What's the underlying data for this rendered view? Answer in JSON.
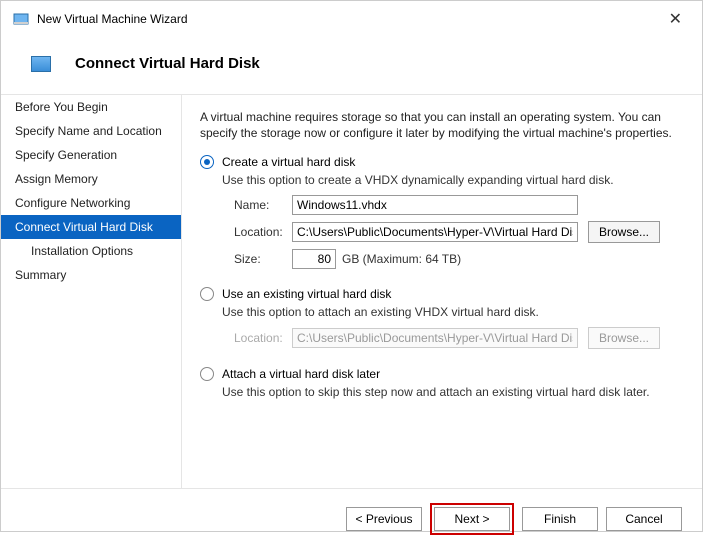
{
  "window": {
    "title": "New Virtual Machine Wizard"
  },
  "header": {
    "title": "Connect Virtual Hard Disk"
  },
  "sidebar": {
    "items": [
      {
        "label": "Before You Begin"
      },
      {
        "label": "Specify Name and Location"
      },
      {
        "label": "Specify Generation"
      },
      {
        "label": "Assign Memory"
      },
      {
        "label": "Configure Networking"
      },
      {
        "label": "Connect Virtual Hard Disk"
      },
      {
        "label": "Installation Options"
      },
      {
        "label": "Summary"
      }
    ]
  },
  "main": {
    "intro": "A virtual machine requires storage so that you can install an operating system. You can specify the storage now or configure it later by modifying the virtual machine's properties.",
    "opt_create": {
      "label": "Create a virtual hard disk",
      "desc": "Use this option to create a VHDX dynamically expanding virtual hard disk.",
      "name_label": "Name:",
      "name_value": "Windows11.vhdx",
      "loc_label": "Location:",
      "loc_value": "C:\\Users\\Public\\Documents\\Hyper-V\\Virtual Hard Disks\\",
      "browse": "Browse...",
      "size_label": "Size:",
      "size_value": "80",
      "size_suffix": "GB (Maximum: 64 TB)"
    },
    "opt_existing": {
      "label": "Use an existing virtual hard disk",
      "desc": "Use this option to attach an existing VHDX virtual hard disk.",
      "loc_label": "Location:",
      "loc_value": "C:\\Users\\Public\\Documents\\Hyper-V\\Virtual Hard Disks\\",
      "browse": "Browse..."
    },
    "opt_later": {
      "label": "Attach a virtual hard disk later",
      "desc": "Use this option to skip this step now and attach an existing virtual hard disk later."
    }
  },
  "footer": {
    "previous": "< Previous",
    "next": "Next >",
    "finish": "Finish",
    "cancel": "Cancel"
  }
}
